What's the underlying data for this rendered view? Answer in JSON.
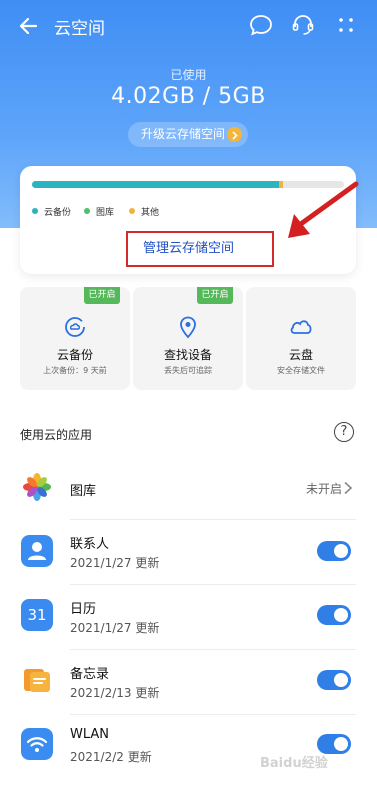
{
  "nav": {
    "title": "云空间"
  },
  "storage": {
    "used_label": "已使用",
    "used_value": "4.02GB / 5GB",
    "upgrade_label": "升级云存储空间",
    "used_fraction": 0.804,
    "breakdown": [
      {
        "label": "云备份",
        "color": "#2cb3c0",
        "fraction": 0.0
      },
      {
        "label": "图库",
        "color": "#4ec06a",
        "fraction": 0.0
      },
      {
        "label": "其他",
        "color": "#f0b43a",
        "fraction": 0.0
      }
    ],
    "manage_label": "管理云存储空间"
  },
  "features": [
    {
      "name": "云备份",
      "sub": "上次备份：9 天前",
      "badge": "已开启"
    },
    {
      "name": "查找设备",
      "sub": "丢失后可追踪",
      "badge": "已开启"
    },
    {
      "name": "云盘",
      "sub": "安全存储文件",
      "badge": ""
    }
  ],
  "section": {
    "title": "使用云的应用",
    "help_icon": "?"
  },
  "apps": [
    {
      "name": "图库",
      "date": "",
      "status": "未开启",
      "enabled": false
    },
    {
      "name": "联系人",
      "date": "2021/1/27 更新",
      "status": "",
      "enabled": true
    },
    {
      "name": "日历",
      "date": "2021/1/27 更新",
      "status": "",
      "enabled": true,
      "icon_text": "31"
    },
    {
      "name": "备忘录",
      "date": "2021/2/13 更新",
      "status": "",
      "enabled": true
    },
    {
      "name": "WLAN",
      "date": "2021/2/2 更新",
      "status": "",
      "enabled": true
    }
  ],
  "watermark": "Baidu经验"
}
